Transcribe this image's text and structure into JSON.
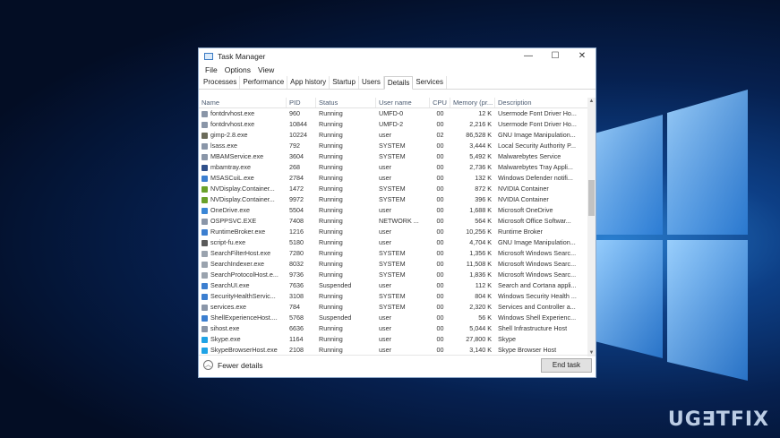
{
  "window": {
    "title": "Task Manager",
    "controls": {
      "minimize": "—",
      "maximize": "☐",
      "close": "✕"
    }
  },
  "menu": [
    "File",
    "Options",
    "View"
  ],
  "tabs": [
    "Processes",
    "Performance",
    "App history",
    "Startup",
    "Users",
    "Details",
    "Services"
  ],
  "active_tab": "Details",
  "columns": {
    "name": "Name",
    "pid": "PID",
    "status": "Status",
    "user": "User name",
    "cpu": "CPU",
    "memory": "Memory (pr...",
    "description": "Description"
  },
  "rows": [
    {
      "name": "fontdrvhost.exe",
      "pid": "960",
      "status": "Running",
      "user": "UMFD-0",
      "cpu": "00",
      "mem": "12 K",
      "desc": "Usermode Font Driver Ho...",
      "icon_color": "#8a96a8"
    },
    {
      "name": "fontdrvhost.exe",
      "pid": "10844",
      "status": "Running",
      "user": "UMFD-2",
      "cpu": "00",
      "mem": "2,216 K",
      "desc": "Usermode Font Driver Ho...",
      "icon_color": "#8a96a8"
    },
    {
      "name": "gimp-2.8.exe",
      "pid": "10224",
      "status": "Running",
      "user": "user",
      "cpu": "02",
      "mem": "86,528 K",
      "desc": "GNU Image Manipulation...",
      "icon_color": "#6b6b5a"
    },
    {
      "name": "lsass.exe",
      "pid": "792",
      "status": "Running",
      "user": "SYSTEM",
      "cpu": "00",
      "mem": "3,444 K",
      "desc": "Local Security Authority P...",
      "icon_color": "#8a96a8"
    },
    {
      "name": "MBAMService.exe",
      "pid": "3604",
      "status": "Running",
      "user": "SYSTEM",
      "cpu": "00",
      "mem": "5,492 K",
      "desc": "Malwarebytes Service",
      "icon_color": "#8a96a8"
    },
    {
      "name": "mbamtray.exe",
      "pid": "268",
      "status": "Running",
      "user": "user",
      "cpu": "00",
      "mem": "2,736 K",
      "desc": "Malwarebytes Tray Appli...",
      "icon_color": "#2f4f8a"
    },
    {
      "name": "MSASCuiL.exe",
      "pid": "2784",
      "status": "Running",
      "user": "user",
      "cpu": "00",
      "mem": "132 K",
      "desc": "Windows Defender notifi...",
      "icon_color": "#3c7fd0"
    },
    {
      "name": "NVDisplay.Container...",
      "pid": "1472",
      "status": "Running",
      "user": "SYSTEM",
      "cpu": "00",
      "mem": "872 K",
      "desc": "NVIDIA Container",
      "icon_color": "#6aa12a"
    },
    {
      "name": "NVDisplay.Container...",
      "pid": "9972",
      "status": "Running",
      "user": "SYSTEM",
      "cpu": "00",
      "mem": "396 K",
      "desc": "NVIDIA Container",
      "icon_color": "#6aa12a"
    },
    {
      "name": "OneDrive.exe",
      "pid": "5504",
      "status": "Running",
      "user": "user",
      "cpu": "00",
      "mem": "1,688 K",
      "desc": "Microsoft OneDrive",
      "icon_color": "#3a86d6"
    },
    {
      "name": "OSPPSVC.EXE",
      "pid": "7408",
      "status": "Running",
      "user": "NETWORK ...",
      "cpu": "00",
      "mem": "564 K",
      "desc": "Microsoft Office Softwar...",
      "icon_color": "#8a96a8"
    },
    {
      "name": "RuntimeBroker.exe",
      "pid": "1216",
      "status": "Running",
      "user": "user",
      "cpu": "00",
      "mem": "10,256 K",
      "desc": "Runtime Broker",
      "icon_color": "#3c7fd0"
    },
    {
      "name": "script-fu.exe",
      "pid": "5180",
      "status": "Running",
      "user": "user",
      "cpu": "00",
      "mem": "4,704 K",
      "desc": "GNU Image Manipulation...",
      "icon_color": "#5b5b5b"
    },
    {
      "name": "SearchFilterHost.exe",
      "pid": "7280",
      "status": "Running",
      "user": "SYSTEM",
      "cpu": "00",
      "mem": "1,356 K",
      "desc": "Microsoft Windows Searc...",
      "icon_color": "#9aa3ae"
    },
    {
      "name": "SearchIndexer.exe",
      "pid": "8032",
      "status": "Running",
      "user": "SYSTEM",
      "cpu": "00",
      "mem": "11,508 K",
      "desc": "Microsoft Windows Searc...",
      "icon_color": "#9aa3ae"
    },
    {
      "name": "SearchProtocolHost.e...",
      "pid": "9736",
      "status": "Running",
      "user": "SYSTEM",
      "cpu": "00",
      "mem": "1,836 K",
      "desc": "Microsoft Windows Searc...",
      "icon_color": "#9aa3ae"
    },
    {
      "name": "SearchUI.exe",
      "pid": "7636",
      "status": "Suspended",
      "user": "user",
      "cpu": "00",
      "mem": "112 K",
      "desc": "Search and Cortana appli...",
      "icon_color": "#3c7fd0"
    },
    {
      "name": "SecurityHealthServic...",
      "pid": "3108",
      "status": "Running",
      "user": "SYSTEM",
      "cpu": "00",
      "mem": "804 K",
      "desc": "Windows Security Health ...",
      "icon_color": "#3c7fd0"
    },
    {
      "name": "services.exe",
      "pid": "784",
      "status": "Running",
      "user": "SYSTEM",
      "cpu": "00",
      "mem": "2,320 K",
      "desc": "Services and Controller a...",
      "icon_color": "#8a96a8"
    },
    {
      "name": "ShellExperienceHost....",
      "pid": "5768",
      "status": "Suspended",
      "user": "user",
      "cpu": "00",
      "mem": "56 K",
      "desc": "Windows Shell Experienc...",
      "icon_color": "#3c7fd0"
    },
    {
      "name": "sihost.exe",
      "pid": "6636",
      "status": "Running",
      "user": "user",
      "cpu": "00",
      "mem": "5,044 K",
      "desc": "Shell Infrastructure Host",
      "icon_color": "#8a96a8"
    },
    {
      "name": "Skype.exe",
      "pid": "1164",
      "status": "Running",
      "user": "user",
      "cpu": "00",
      "mem": "27,800 K",
      "desc": "Skype",
      "icon_color": "#1fa3e6"
    },
    {
      "name": "SkypeBrowserHost.exe",
      "pid": "2108",
      "status": "Running",
      "user": "user",
      "cpu": "00",
      "mem": "3,140 K",
      "desc": "Skype Browser Host",
      "icon_color": "#1fa3e6"
    }
  ],
  "footer": {
    "fewer_details": "Fewer details",
    "end_task": "End task"
  },
  "watermark": "UG∃TFIX"
}
